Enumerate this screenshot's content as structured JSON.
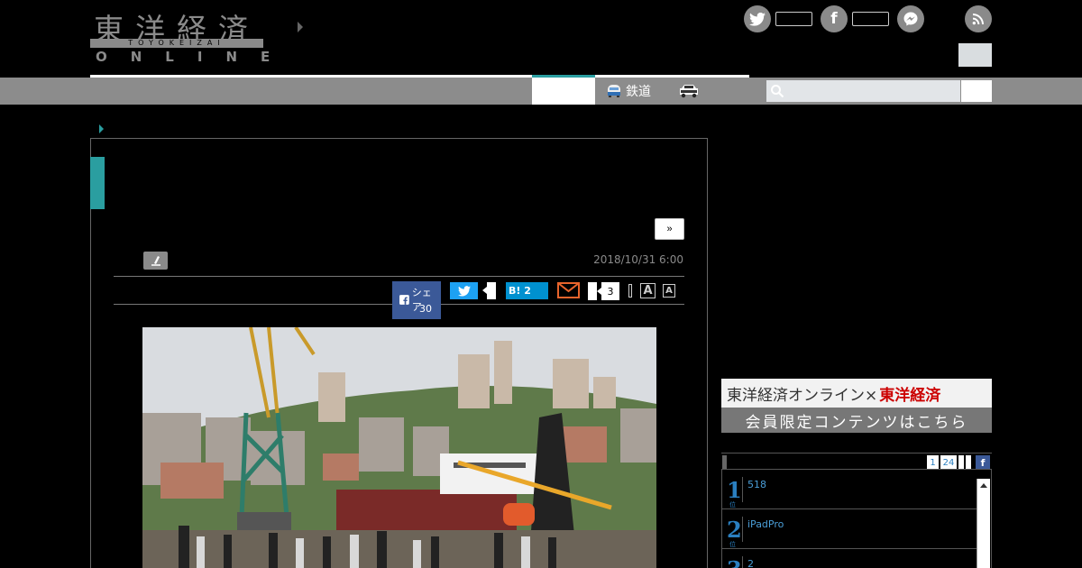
{
  "logo": {
    "kanji": "東洋経済",
    "romaji": "TOYOKEIZAI",
    "online": "ONLINE"
  },
  "nav": {
    "rail_label": "鉄道",
    "search_placeholder": ""
  },
  "article": {
    "next_label": "»",
    "date": "2018/10/31 6:00"
  },
  "share": {
    "facebook_label": "シェア",
    "facebook_count": "30",
    "hatena_label": "B!",
    "hatena_count": "2",
    "comment_count": "3",
    "font_large": "A",
    "font_small": "A"
  },
  "banner": {
    "line1_prefix": "東洋経済オンライン×",
    "line1_brand": "東洋経済",
    "line2": "会員限定コンテンツはこちら"
  },
  "ranking": {
    "tabs": [
      "1",
      "24"
    ],
    "items": [
      {
        "rank": "1",
        "sub": "位",
        "title": "518"
      },
      {
        "rank": "2",
        "sub": "位",
        "title": "iPadPro"
      },
      {
        "rank": "3",
        "sub": "位",
        "title": "2"
      }
    ]
  },
  "colors": {
    "accent": "#2a9ea0",
    "nav_gray": "#8c8c8c",
    "facebook": "#3b5998",
    "twitter": "#1da1f2",
    "hatena": "#0091d0"
  }
}
